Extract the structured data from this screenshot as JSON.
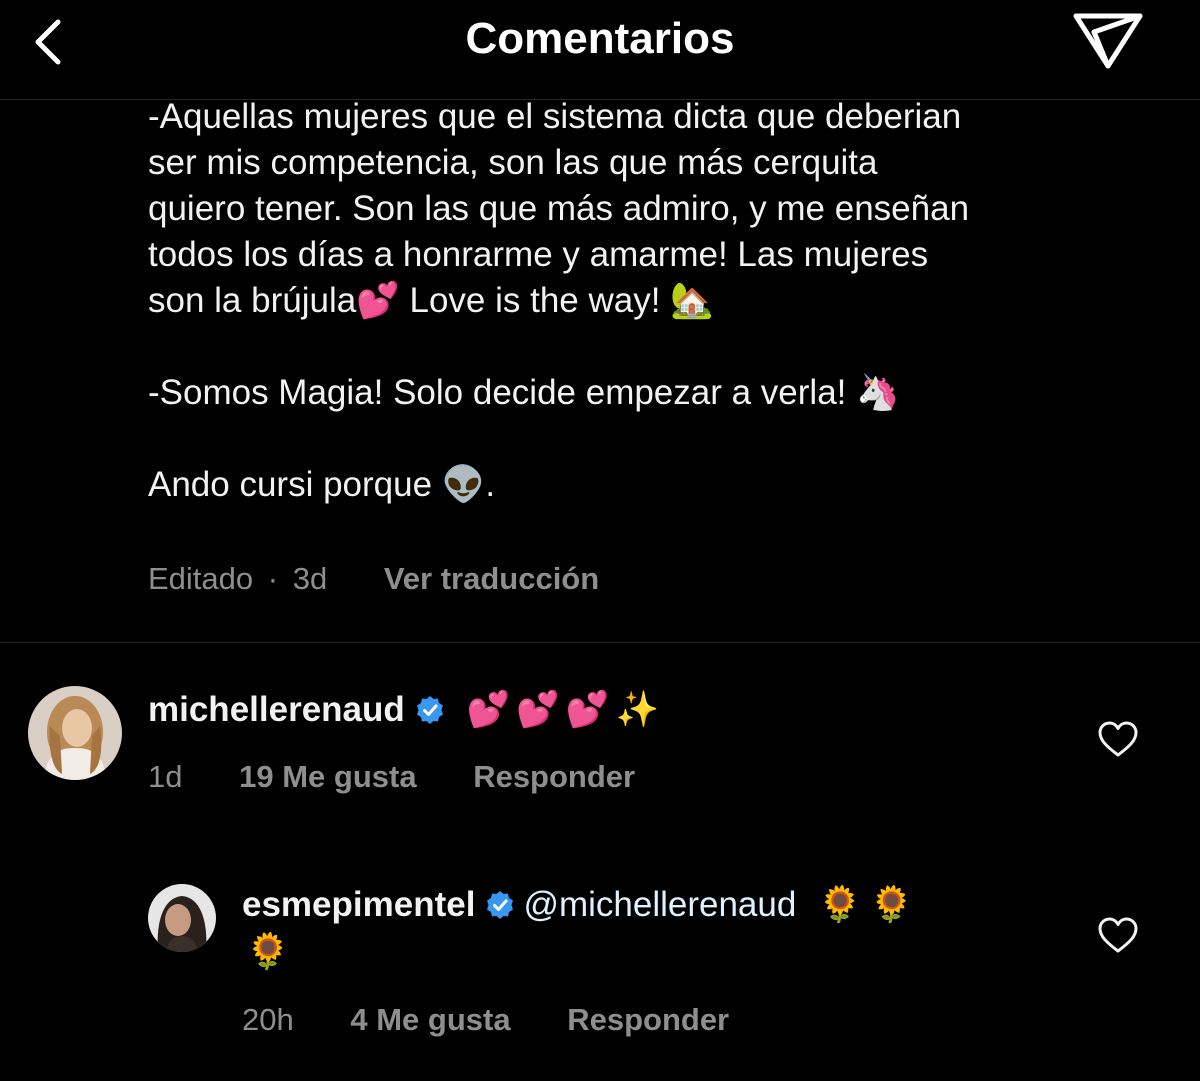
{
  "header": {
    "title": "Comentarios",
    "back_icon": "chevron-left-icon",
    "share_icon": "paper-plane-icon"
  },
  "caption": {
    "lines": [
      "-Aquellas mujeres que el sistema dicta que deberian",
      "ser mis competencia, son las que más cerquita",
      "quiero tener. Son las que más admiro, y me enseñan",
      "todos los días a honrarme y amarme! Las mujeres",
      "son la brújula💕 Love is the way! 🏡",
      "-Somos Magia! Solo decide empezar a verla! 🦄",
      "Ando cursi porque 👽."
    ],
    "edited_label": "Editado",
    "separator": "·",
    "time": "3d",
    "translate_label": "Ver traducción"
  },
  "comments": [
    {
      "username": "michellerenaud",
      "verified": true,
      "text": "💕💕💕✨",
      "time": "1d",
      "likes_label": "19 Me gusta",
      "reply_label": "Responder",
      "avatar_icon": "avatar-image",
      "like_icon": "heart-outline-icon"
    },
    {
      "username": "esmepimentel",
      "verified": true,
      "mention": "@michellerenaud",
      "text_line1": "🌻🌻",
      "text_line2": "🌻",
      "time": "20h",
      "likes_label": "4 Me gusta",
      "reply_label": "Responder",
      "avatar_icon": "avatar-image",
      "like_icon": "heart-outline-icon"
    }
  ],
  "colors": {
    "background": "#000000",
    "text": "#f2f2f2",
    "muted": "#8e8e8e",
    "verified": "#3897f0",
    "divider": "#262626"
  }
}
